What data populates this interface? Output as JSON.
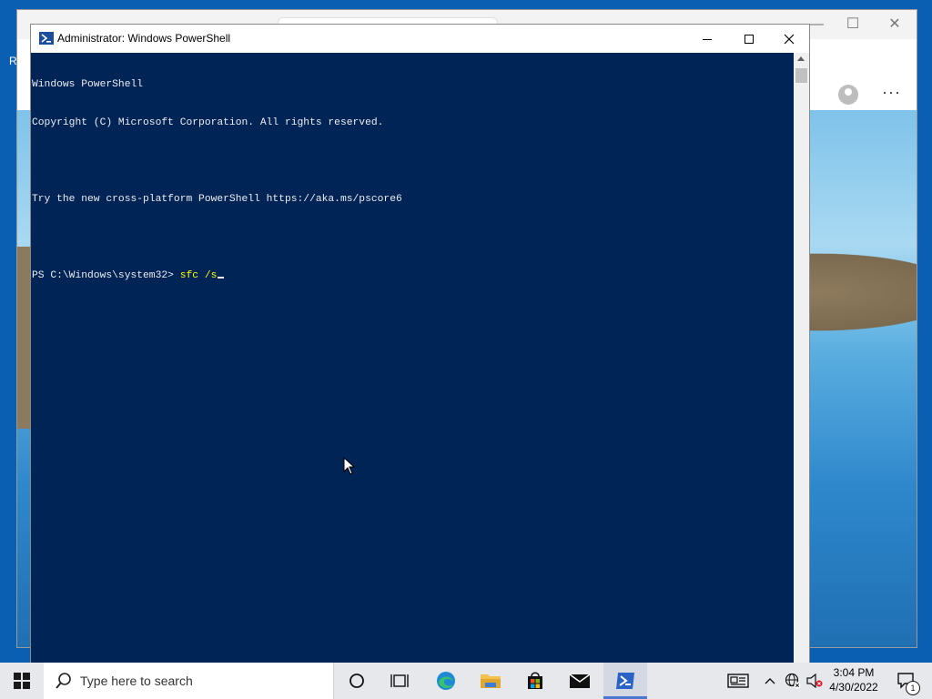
{
  "desktop": {
    "edge_text": "R"
  },
  "background_window": {
    "controls": {
      "minimize": "—",
      "maximize": "☐",
      "close": "✕"
    },
    "more_label": "···"
  },
  "powershell": {
    "title": "Administrator: Windows PowerShell",
    "lines": [
      "Windows PowerShell",
      "Copyright (C) Microsoft Corporation. All rights reserved.",
      "",
      "Try the new cross-platform PowerShell https://aka.ms/pscore6",
      ""
    ],
    "prompt": "PS C:\\Windows\\system32> ",
    "command": "sfc /s"
  },
  "taskbar": {
    "search_placeholder": "Type here to search",
    "time": "3:04 PM",
    "date": "4/30/2022",
    "notification_count": "1",
    "colors": {
      "accent": "#4a78d0",
      "console_bg": "#012456",
      "command": "#ffff00"
    }
  }
}
